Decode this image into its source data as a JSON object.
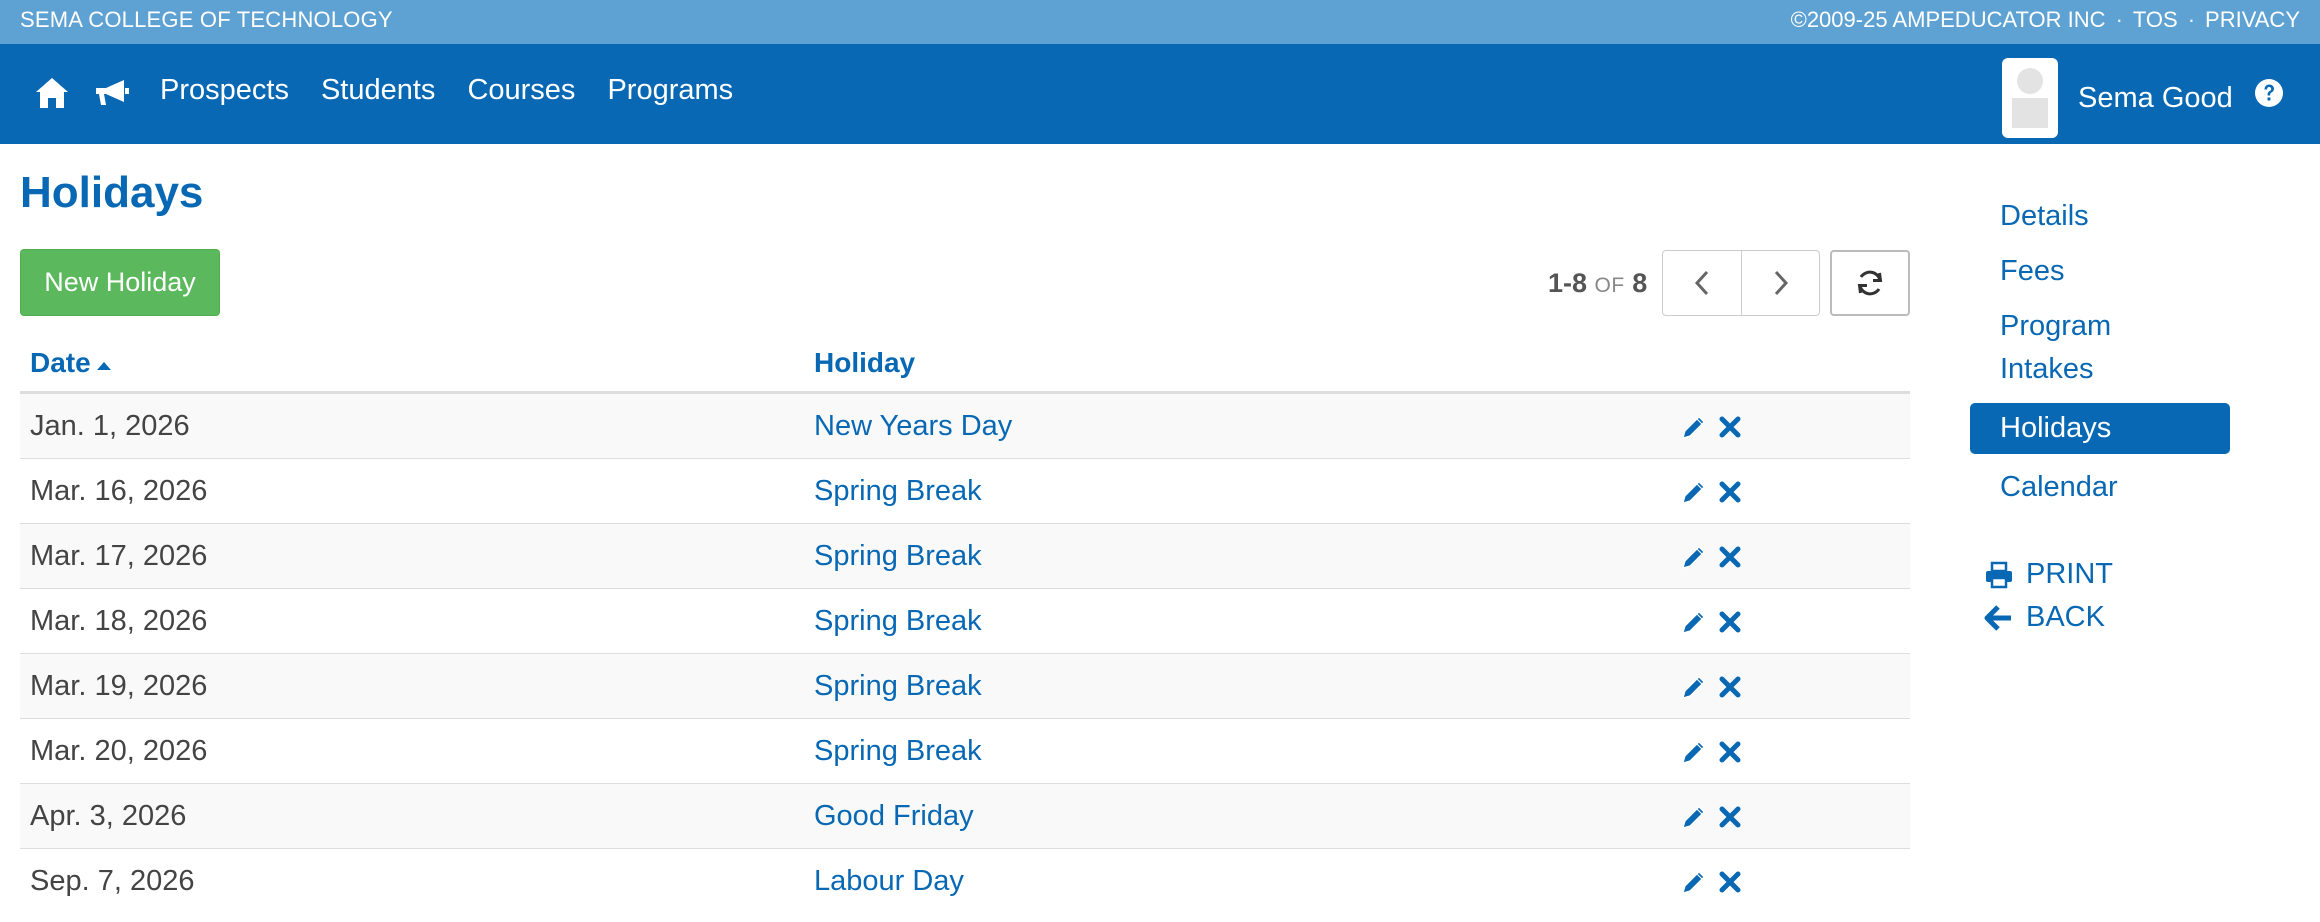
{
  "topbar": {
    "school": "SEMA COLLEGE OF TECHNOLOGY",
    "copyright": "©2009-25 AMPEDUCATOR INC",
    "separator": "·",
    "tos": "TOS",
    "privacy": "PRIVACY",
    "background": "#5ea2d3"
  },
  "navbar": {
    "background": "#0868b4",
    "icons": [
      "home-icon",
      "megaphone-icon"
    ],
    "links": [
      "Prospects",
      "Students",
      "Courses",
      "Programs"
    ],
    "user_name": "Sema Good",
    "help_icon": "question-circle-icon"
  },
  "page": {
    "title": "Holidays",
    "new_button": "New Holiday",
    "pager": {
      "range": "1-8",
      "of": "OF",
      "total": "8"
    }
  },
  "table": {
    "columns": [
      "Date",
      "Holiday"
    ],
    "rows": [
      {
        "date": "Jan. 1, 2026",
        "holiday": "New Years Day"
      },
      {
        "date": "Mar. 16, 2026",
        "holiday": "Spring Break"
      },
      {
        "date": "Mar. 17, 2026",
        "holiday": "Spring Break"
      },
      {
        "date": "Mar. 18, 2026",
        "holiday": "Spring Break"
      },
      {
        "date": "Mar. 19, 2026",
        "holiday": "Spring Break"
      },
      {
        "date": "Mar. 20, 2026",
        "holiday": "Spring Break"
      },
      {
        "date": "Apr. 3, 2026",
        "holiday": "Good Friday"
      },
      {
        "date": "Sep. 7, 2026",
        "holiday": "Labour Day"
      }
    ]
  },
  "sidemenu": {
    "items": [
      "Details",
      "Fees",
      "Program Intakes",
      "Holidays",
      "Calendar"
    ],
    "active": "Holidays",
    "print": "PRINT",
    "back": "BACK"
  },
  "colors": {
    "primary": "#0868b4",
    "success": "#5cb85c"
  }
}
